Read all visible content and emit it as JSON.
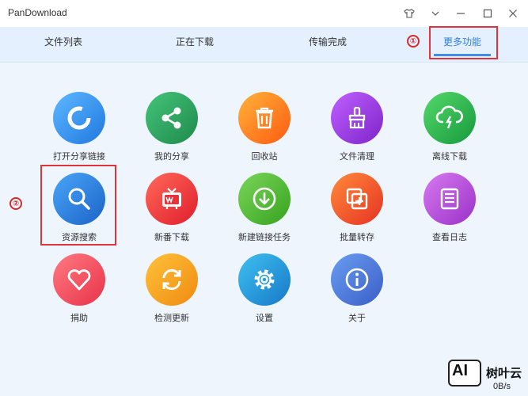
{
  "app": {
    "title": "PanDownload"
  },
  "tabs": [
    {
      "label": "文件列表"
    },
    {
      "label": "正在下载"
    },
    {
      "label": "传输完成"
    },
    {
      "label": "更多功能"
    }
  ],
  "annotations": {
    "marker1": "①",
    "marker2": "②"
  },
  "features": [
    {
      "label": "打开分享链接",
      "icon": "refresh-ring-icon",
      "color": "#2196f3"
    },
    {
      "label": "我的分享",
      "icon": "share-icon",
      "color": "#2e9b5e"
    },
    {
      "label": "回收站",
      "icon": "trash-icon",
      "color": "#ff7a1a"
    },
    {
      "label": "文件清理",
      "icon": "brush-icon",
      "color": "#a23fd6"
    },
    {
      "label": "离线下载",
      "icon": "cloud-download-icon",
      "color": "#27b44f"
    },
    {
      "label": "资源搜索",
      "icon": "search-icon",
      "color": "#2b83e6"
    },
    {
      "label": "新番下载",
      "icon": "tv-icon",
      "color": "#ef3b3b"
    },
    {
      "label": "新建链接任务",
      "icon": "download-icon",
      "color": "#5bbf3a"
    },
    {
      "label": "批量转存",
      "icon": "copy-add-icon",
      "color": "#f25b2b"
    },
    {
      "label": "查看日志",
      "icon": "log-icon",
      "color": "#b44ad8"
    },
    {
      "label": "捐助",
      "icon": "heart-icon",
      "color": "#ef4d5b"
    },
    {
      "label": "检测更新",
      "icon": "update-icon",
      "color": "#f6a21d"
    },
    {
      "label": "设置",
      "icon": "gear-icon",
      "color": "#1f9ad8"
    },
    {
      "label": "关于",
      "icon": "info-icon",
      "color": "#4f7fd8"
    }
  ],
  "watermark": {
    "logo_text": "AI",
    "name": "树叶云",
    "speed": "0B/s"
  }
}
